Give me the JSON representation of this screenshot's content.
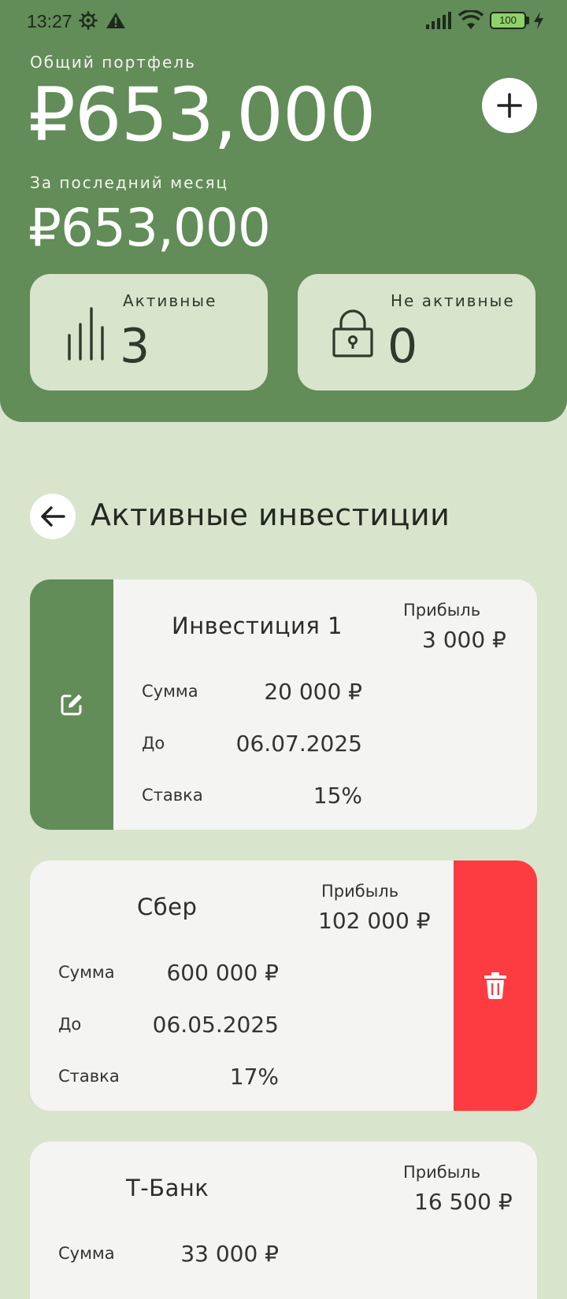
{
  "status_bar": {
    "time": "13:27",
    "battery": "100",
    "icons": [
      "gear-icon",
      "warning-icon",
      "signal-icon",
      "wifi-icon",
      "battery-icon",
      "charging-icon"
    ]
  },
  "portfolio": {
    "total_label": "Общий портфель",
    "total_value": "₽653,000",
    "month_label": "За последний месяц",
    "month_value": "₽653,000"
  },
  "stats": {
    "active_label": "Активные",
    "active_count": "3",
    "inactive_label": "Не активные",
    "inactive_count": "0"
  },
  "section": {
    "title": "Активные инвестиции"
  },
  "colors": {
    "header_green": "#628c58",
    "background": "#d8e4cc",
    "card": "#f4f4f2",
    "delete_red": "#fc3c41"
  },
  "investments": [
    {
      "name": "Инвестиция 1",
      "profit_label": "Прибыль",
      "profit": "3 000 ₽",
      "amount_label": "Сумма",
      "amount": "20 000 ₽",
      "until_label": "До",
      "until": "06.07.2025",
      "rate_label": "Ставка",
      "rate": "15%"
    },
    {
      "name": "Сбер",
      "profit_label": "Прибыль",
      "profit": "102 000 ₽",
      "amount_label": "Сумма",
      "amount": "600 000 ₽",
      "until_label": "До",
      "until": "06.05.2025",
      "rate_label": "Ставка",
      "rate": "17%"
    },
    {
      "name": "Т-Банк",
      "profit_label": "Прибыль",
      "profit": "16 500 ₽",
      "amount_label": "Сумма",
      "amount": "33 000 ₽"
    }
  ]
}
